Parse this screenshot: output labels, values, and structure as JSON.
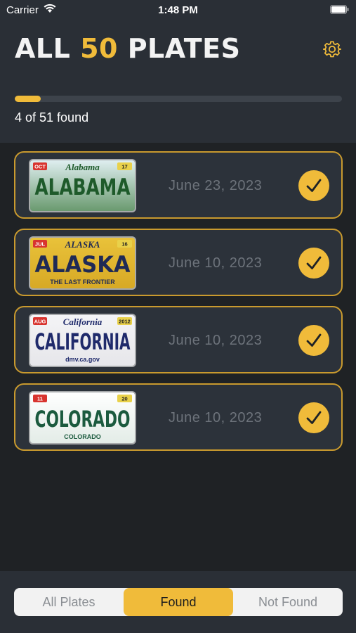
{
  "status_bar": {
    "carrier": "Carrier",
    "time": "1:48 PM"
  },
  "header": {
    "title_prefix": "ALL ",
    "title_number": "50",
    "title_suffix": " PLATES",
    "progress_fraction": 0.0784,
    "progress_text": "4 of 51 found",
    "accent_color": "#f0bb3a"
  },
  "plates": [
    {
      "state": "ALABAMA",
      "plate_header": "Alabama",
      "plate_footer": "",
      "tag_left": "OCT",
      "tag_right": "17",
      "date": "June 23, 2023",
      "bg_top": "#dfeef0",
      "bg_bottom": "#6a9a6f",
      "text_color": "#1e5a2a"
    },
    {
      "state": "ALASKA",
      "plate_header": "ALASKA",
      "plate_footer": "THE LAST FRONTIER",
      "tag_left": "JUL",
      "tag_right": "16",
      "date": "June 10, 2023",
      "bg_top": "#e9c23a",
      "bg_bottom": "#d7a925",
      "text_color": "#1f2a55"
    },
    {
      "state": "CALIFORNIA",
      "plate_header": "California",
      "plate_footer": "dmv.ca.gov",
      "tag_left": "AUG",
      "tag_right": "2012",
      "date": "June 10, 2023",
      "bg_top": "#f4f4f6",
      "bg_bottom": "#e6e6ea",
      "text_color": "#1f2a6b"
    },
    {
      "state": "COLORADO",
      "plate_header": "",
      "plate_footer": "COLORADO",
      "tag_left": "11",
      "tag_right": "20",
      "date": "June 10, 2023",
      "bg_top": "#ffffff",
      "bg_bottom": "#e3ece7",
      "text_color": "#1b5a3e"
    }
  ],
  "tabs": {
    "all": "All Plates",
    "found": "Found",
    "not_found": "Not Found",
    "selected": "found"
  }
}
